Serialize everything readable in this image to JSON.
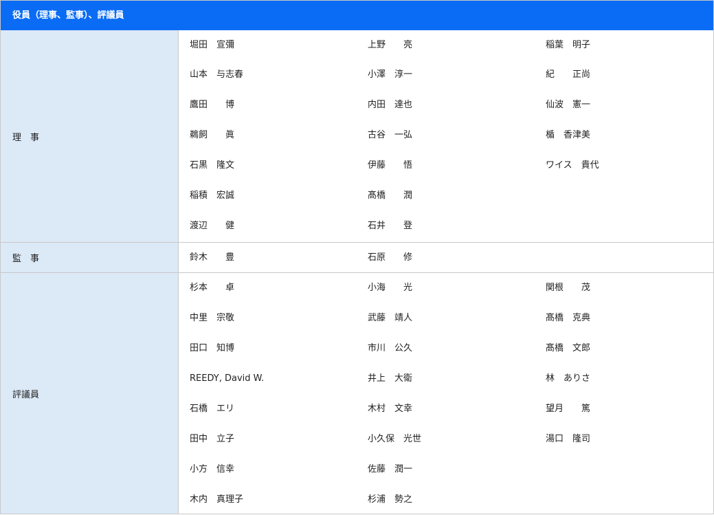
{
  "header": {
    "title": "役員（理事、監事）、評議員"
  },
  "sections": [
    {
      "label": "理　事",
      "names": [
        "堀田　宣彌",
        "上野　　亮",
        "稲葉　明子",
        "山本　与志春",
        "小澤　淳一",
        "紀　　正尚",
        "鷹田　　博",
        "内田　達也",
        "仙波　憲一",
        "鵜飼　　眞",
        "古谷　一弘",
        "楯　香津美",
        "石黒　隆文",
        "伊藤　　悟",
        "ワイス　貴代",
        "稲積　宏誠",
        "髙橋　　潤",
        "",
        "渡辺　　健",
        "石井　　登",
        ""
      ]
    },
    {
      "label": "監　事",
      "names": [
        "鈴木　　豊",
        "石原　　修",
        ""
      ]
    },
    {
      "label": "評議員",
      "names": [
        "杉本　　卓",
        "小海　　光",
        "関根　　茂",
        "中里　宗敬",
        "武藤　靖人",
        "髙橋　克典",
        "田口　知博",
        "市川　公久",
        "髙橋　文郎",
        "REEDY, David W.",
        "井上　大衛",
        "林　ありさ",
        "石橋　エリ",
        "木村　文幸",
        "望月　　篤",
        "田中　立子",
        "小久保　光世",
        "湯口　隆司",
        "小方　信幸",
        "佐藤　潤一",
        "",
        "木内　真理子",
        "杉浦　勢之",
        ""
      ]
    }
  ]
}
